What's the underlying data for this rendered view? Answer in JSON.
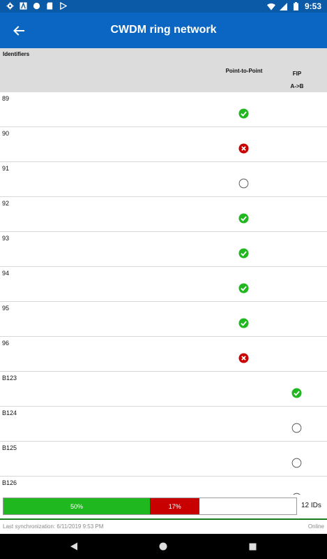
{
  "status_bar": {
    "time": "9:53",
    "icons_left": [
      "gear-icon",
      "a-icon",
      "circle-icon",
      "sd-card-icon",
      "play-icon"
    ],
    "icons_right": [
      "wifi-icon",
      "signal-icon",
      "battery-icon"
    ]
  },
  "app_bar": {
    "title": "CWDM ring network",
    "back_icon": "arrow-left-icon"
  },
  "table": {
    "header": {
      "identifiers": "Identifiers",
      "point_to_point": "Point-to-Point",
      "fip_line1": "FIP",
      "fip_line2": "A->B"
    },
    "rows": [
      {
        "id": "89",
        "p2p": "pass",
        "fip": "none"
      },
      {
        "id": "90",
        "p2p": "fail",
        "fip": "none"
      },
      {
        "id": "91",
        "p2p": "pending",
        "fip": "none"
      },
      {
        "id": "92",
        "p2p": "pass",
        "fip": "none"
      },
      {
        "id": "93",
        "p2p": "pass",
        "fip": "none"
      },
      {
        "id": "94",
        "p2p": "pass",
        "fip": "none"
      },
      {
        "id": "95",
        "p2p": "pass",
        "fip": "none"
      },
      {
        "id": "96",
        "p2p": "fail",
        "fip": "none"
      },
      {
        "id": "B123",
        "p2p": "none",
        "fip": "pass"
      },
      {
        "id": "B124",
        "p2p": "none",
        "fip": "pending"
      },
      {
        "id": "B125",
        "p2p": "none",
        "fip": "pending"
      },
      {
        "id": "B126",
        "p2p": "none",
        "fip": "pending"
      }
    ]
  },
  "progress": {
    "pass_label": "50%",
    "pass_fraction": 0.5,
    "fail_label": "17%",
    "fail_fraction": 0.17,
    "ids_label": "12 IDs"
  },
  "footer": {
    "sync": "Last synchronization: 6/11/2019 9:53 PM",
    "status": "Online"
  },
  "colors": {
    "status_bar": "#0a5aa8",
    "app_bar": "#0a66c2",
    "pass": "#1fb81f",
    "fail": "#c80000"
  }
}
